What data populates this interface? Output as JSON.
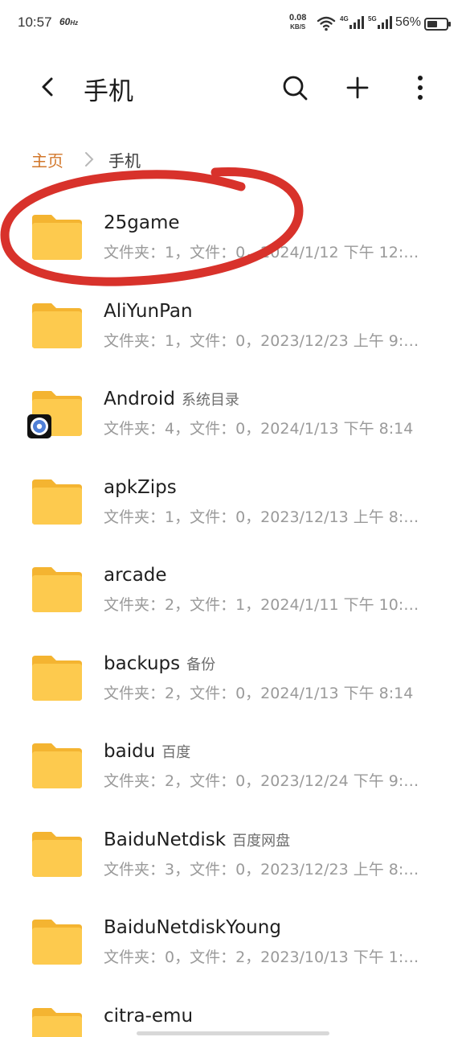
{
  "status_bar": {
    "time": "10:57",
    "refresh": "60",
    "refresh_unit": "Hz",
    "net_speed": "0.08",
    "net_unit": "KB/S",
    "sig1_label": "4G",
    "sig2_label": "5G",
    "battery": "56%",
    "battery_level": 0.56
  },
  "toolbar": {
    "title": "手机",
    "back_icon": "back-arrow-icon",
    "search_icon": "search-icon",
    "add_icon": "add-icon",
    "more_icon": "more-vertical-icon"
  },
  "breadcrumb": {
    "home": "主页",
    "current": "手机"
  },
  "colors": {
    "accent": "#d2772b",
    "folder": "#fcc64a",
    "annotation": "#d8322b"
  },
  "files": [
    {
      "name": "25game",
      "tag": "",
      "meta": "文件夹：1，文件：0，2024/1/12 下午 12:…"
    },
    {
      "name": "AliYunPan",
      "tag": "",
      "meta": "文件夹：1，文件：0，2023/12/23 上午 9:…"
    },
    {
      "name": "Android",
      "tag": "系统目录",
      "meta": "文件夹：4，文件：0，2024/1/13 下午 8:14"
    },
    {
      "name": "apkZips",
      "tag": "",
      "meta": "文件夹：1，文件：0，2023/12/13 上午 8:…"
    },
    {
      "name": "arcade",
      "tag": "",
      "meta": "文件夹：2，文件：1，2024/1/11 下午 10:…"
    },
    {
      "name": "backups",
      "tag": "备份",
      "meta": "文件夹：2，文件：0，2024/1/13 下午 8:14"
    },
    {
      "name": "baidu",
      "tag": "百度",
      "meta": "文件夹：2，文件：0，2023/12/24 下午 9:…"
    },
    {
      "name": "BaiduNetdisk",
      "tag": "百度网盘",
      "meta": "文件夹：3，文件：0，2023/12/23 上午 8:…"
    },
    {
      "name": "BaiduNetdiskYoung",
      "tag": "",
      "meta": "文件夹：0，文件：2，2023/10/13 下午 1:…"
    },
    {
      "name": "citra-emu",
      "tag": "",
      "meta": ""
    }
  ]
}
